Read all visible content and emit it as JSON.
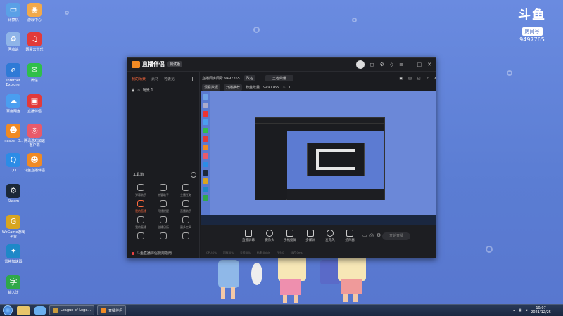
{
  "watermark": {
    "logo": "斗鱼",
    "tag": "房间号",
    "room_id": "9497765"
  },
  "desktop_icons": [
    {
      "label": "计算机",
      "icon": "computer-icon",
      "color": "#5aa0e6"
    },
    {
      "label": "游戏中心",
      "icon": "game-center-icon",
      "color": "#f2a94a"
    },
    {
      "label": "回收站",
      "icon": "recycle-bin-icon",
      "color": "#8fb4e8"
    },
    {
      "label": "网易云音乐",
      "icon": "netease-music-icon",
      "color": "#e23a3a"
    },
    {
      "label": "Internet Explorer",
      "icon": "ie-icon",
      "color": "#2f7ad6"
    },
    {
      "label": "微信",
      "icon": "wechat-icon",
      "color": "#2fbf4a"
    },
    {
      "label": "百度网盘",
      "icon": "baidu-netdisk-icon",
      "color": "#4a9ef0"
    },
    {
      "label": "直播伴侣",
      "icon": "live-companion-icon",
      "color": "#e23a3a"
    },
    {
      "label": "master_D...",
      "icon": "master-icon",
      "color": "#f08a24"
    },
    {
      "label": "腾讯游戏加速客户端",
      "icon": "accelerator-icon",
      "color": "#e85a6a"
    },
    {
      "label": "QQ",
      "icon": "qq-icon",
      "color": "#2c8ce6"
    },
    {
      "label": "斗鱼直播伴侣",
      "icon": "douyu-companion-icon",
      "color": "#f08a24"
    },
    {
      "label": "Steam",
      "icon": "steam-icon",
      "color": "#1b2838"
    },
    {
      "label": "WeGame游戏平台",
      "icon": "wegame-icon",
      "color": "#d8a520"
    },
    {
      "label": "雷神加速器",
      "icon": "leishen-icon",
      "color": "#1e88c8"
    },
    {
      "label": "输入法",
      "icon": "input-method-icon",
      "color": "#2fa84a"
    }
  ],
  "app": {
    "name": "直播伴侣",
    "version": "测试版",
    "tabs": [
      "我的场景",
      "素材",
      "可去见"
    ],
    "scene_name": "场景 1",
    "tools_title": "工具箱",
    "tools": [
      {
        "label": "弹幕助手",
        "icon": "danmu-icon"
      },
      {
        "label": "房管助手",
        "icon": "room-admin-icon"
      },
      {
        "label": "主播任务",
        "icon": "task-icon"
      },
      {
        "label": "我的直播",
        "icon": "my-live-icon"
      },
      {
        "label": "开播提醒",
        "icon": "remind-icon"
      },
      {
        "label": "直播助手",
        "icon": "assistant-icon"
      },
      {
        "label": "我的直播",
        "icon": "download-icon"
      },
      {
        "label": "主播日历",
        "icon": "download-icon"
      },
      {
        "label": "更多工具",
        "icon": "download-icon"
      },
      {
        "label": "",
        "icon": "download-icon"
      },
      {
        "label": "",
        "icon": "download-icon"
      },
      {
        "label": "",
        "icon": "download-icon"
      }
    ],
    "footer_text": "斗鱼直播伴侣使用指南",
    "room_label": "直播间房间号 9497765",
    "room_btn": "改名",
    "category": "王者荣耀",
    "tag1": "观看数据",
    "tag2": "开播推荐",
    "fans_label": "粉丝数量",
    "fans_value": "9497765",
    "likes": "0",
    "bottom_items": [
      "直播屏幕",
      "摄像头",
      "手机投屏",
      "多媒体",
      "麦克风",
      "扬声器"
    ],
    "start_btn": "开始直播",
    "stats": [
      "CPU:0%",
      "内存:0%",
      "丢帧:0%",
      "码率:0kb/s",
      "FPS:0",
      "延迟:0ms"
    ]
  },
  "taskbar": {
    "tasks": [
      {
        "label": "League of Lege...",
        "color": "#c89b3c"
      },
      {
        "label": "直播伴侣",
        "color": "#f08a24"
      }
    ],
    "time": "10:07",
    "date": "2021/12/25"
  }
}
